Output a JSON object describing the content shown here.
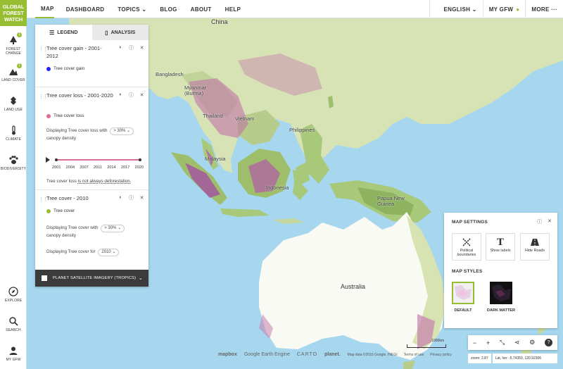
{
  "brand": {
    "line1": "GLOBAL",
    "line2": "FOREST",
    "line3": "WATCH"
  },
  "nav": {
    "items": [
      {
        "label": "MAP"
      },
      {
        "label": "DASHBOARD"
      },
      {
        "label": "TOPICS ⌄"
      },
      {
        "label": "BLOG"
      },
      {
        "label": "ABOUT"
      },
      {
        "label": "HELP"
      }
    ],
    "right": {
      "language": "ENGLISH ⌄",
      "my_gfw": "MY GFW",
      "more": "MORE ···"
    }
  },
  "sidebar": {
    "items": [
      {
        "label": "FOREST CHANGE"
      },
      {
        "label": "LAND COVER"
      },
      {
        "label": "LAND USE"
      },
      {
        "label": "CLIMATE"
      },
      {
        "label": "BIODIVERSITY"
      }
    ],
    "bottom": [
      {
        "label": "EXPLORE"
      },
      {
        "label": "SEARCH"
      },
      {
        "label": "MY GFW"
      }
    ],
    "badge": "1"
  },
  "legend": {
    "tabs": {
      "legend": "LEGEND",
      "analysis": "ANALYSIS"
    },
    "layers": [
      {
        "title": "Tree cover gain - 2001-2012",
        "legend": "Tree cover gain",
        "color": "#2323ff"
      },
      {
        "title": "Tree cover loss - 2001-2020",
        "legend": "Tree cover loss",
        "color": "#dc6c9a",
        "desc1": "Displaying Tree cover loss with",
        "density": "> 30% ⌄",
        "desc2": "canopy density",
        "years": [
          "2001",
          "2004",
          "2007",
          "2011",
          "2014",
          "2017",
          "2020"
        ],
        "note_prefix": "Tree cover loss ",
        "note_link": "is not always deforestation."
      },
      {
        "title": "Tree cover - 2010",
        "legend": "Tree cover",
        "color": "#97be32",
        "desc1": "Displaying Tree cover with",
        "density": "> 30% ⌄",
        "desc2": "canopy density",
        "desc3": "Displaying Tree cover for",
        "year": "2010 ⌄"
      }
    ],
    "planet": "PLANET SATELLITE IMAGERY (TROPICS)"
  },
  "map_labels": {
    "china": "China",
    "bangladesh": "Bangladesh",
    "myanmar": "Myanmar (Burma)",
    "thailand": "Thailand",
    "vietnam": "Vietnam",
    "philippines": "Philippines",
    "malaysia": "Malaysia",
    "indonesia": "Indonesia",
    "png": "Papua New Guinea",
    "australia": "Australia"
  },
  "settings": {
    "title": "MAP SETTINGS",
    "buttons": [
      {
        "label": "Political boundaries"
      },
      {
        "label": "Show labels"
      },
      {
        "label": "Hide Roads"
      }
    ],
    "styles_title": "MAP STYLES",
    "styles": [
      {
        "label": "DEFAULT"
      },
      {
        "label": "DARK MATTER"
      }
    ]
  },
  "controls": {
    "minus": "−",
    "plus": "+",
    "fullscreen": "⤡",
    "share": "⋖",
    "settings": "⚙",
    "help": "?"
  },
  "status": {
    "zoom": "zoom: 2.87",
    "latlon": "Lat, lon: -5.74350, 120.92306"
  },
  "attribution": {
    "mapbox": "mapbox",
    "gee": "Google Earth Engine",
    "carto": "CARTO",
    "planet": "planet.",
    "mapdata": "Map data ©2016 Google, INEGI",
    "terms": "Terms of use",
    "privacy": "Privacy policy"
  },
  "scale": "1000km"
}
